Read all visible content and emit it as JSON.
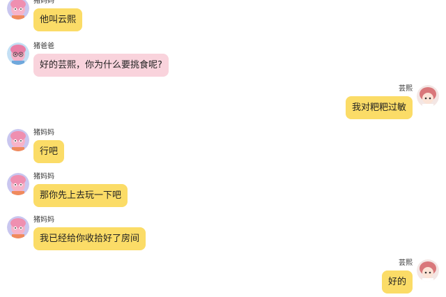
{
  "messages": [
    {
      "side": "left",
      "sender": "猪妈妈",
      "avatar": "peppa-mom-avatar",
      "text": "他叫云熙",
      "bubble_color": "#fbdc67"
    },
    {
      "side": "left",
      "sender": "猪爸爸",
      "avatar": "peppa-dad-avatar",
      "text": "好的芸熙，你为什么要挑食呢?",
      "bubble_color": "#f9d3dc"
    },
    {
      "side": "right",
      "sender": "芸熙",
      "avatar": "yunxi-avatar",
      "text": "我对粑粑过敏",
      "bubble_color": "#fbdc67"
    },
    {
      "side": "left",
      "sender": "猪妈妈",
      "avatar": "peppa-mom-avatar",
      "text": "行吧",
      "bubble_color": "#fbdc67"
    },
    {
      "side": "left",
      "sender": "猪妈妈",
      "avatar": "peppa-mom-avatar",
      "text": "那你先上去玩一下吧",
      "bubble_color": "#fbdc67"
    },
    {
      "side": "left",
      "sender": "猪妈妈",
      "avatar": "peppa-mom-avatar",
      "text": "我已经给你收拾好了房间",
      "bubble_color": "#fbdc67"
    },
    {
      "side": "right",
      "sender": "芸熙",
      "avatar": "yunxi-avatar",
      "text": "好的",
      "bubble_color": "#fbdc67"
    }
  ]
}
